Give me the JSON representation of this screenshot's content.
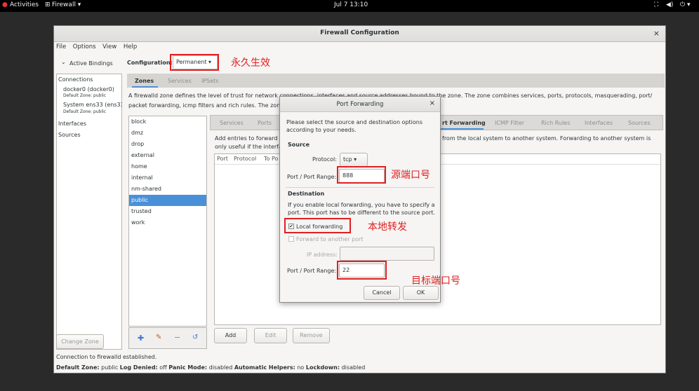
{
  "topbar": {
    "activities": "Activities",
    "app_menu": "Firewall ▾",
    "clock": "Jul 7 13:10"
  },
  "window": {
    "title": "Firewall Configuration",
    "close": "×",
    "menu": [
      "File",
      "Options",
      "View",
      "Help"
    ]
  },
  "left": {
    "active_bindings": "Active Bindings",
    "connections_header": "Connections",
    "conn1_name": "docker0 (docker0)",
    "conn1_zone": "Default Zone: public",
    "conn2_name": "System ens33 (ens33)",
    "conn2_zone": "Default Zone: public",
    "interfaces": "Interfaces",
    "sources": "Sources",
    "change_zone": "Change Zone"
  },
  "config": {
    "label": "Configuration:",
    "value": "Permanent ▾",
    "annotation": "永久生效"
  },
  "top_tabs": [
    "Zones",
    "Services",
    "IPSets"
  ],
  "zone_desc_1": "A firewalld zone defines the level of trust for network connections, interfaces and source addresses bound to the zone. The zone combines services, ports, protocols, masquerading, port/",
  "zone_desc_2": "packet forwarding, icmp filters and rich rules. The zone",
  "zones": [
    "block",
    "dmz",
    "drop",
    "external",
    "home",
    "internal",
    "nm-shared",
    "public",
    "trusted",
    "work"
  ],
  "selected_zone": "public",
  "sub_tabs": {
    "services": "Services",
    "ports": "Ports",
    "port_forwarding": "rt Forwarding",
    "icmp": "ICMP Filter",
    "rich": "Rich Rules",
    "interfaces": "Interfaces",
    "sources": "Sources"
  },
  "pf_desc_left_1": "Add entries to forward p",
  "pf_desc_left_2": "only useful if the interfa",
  "pf_desc_right": "from the local system to another system. Forwarding to another system is",
  "table_headers": [
    "Port",
    "Protocol",
    "To Po"
  ],
  "buttons": {
    "add": "Add",
    "edit": "Edit",
    "remove": "Remove"
  },
  "statusbar": {
    "line1": "Connection to firewalld established.",
    "default_zone_label": "Default Zone:",
    "default_zone": "public",
    "log_denied_label": "Log Denied:",
    "log_denied": "off",
    "panic_label": "Panic Mode:",
    "panic": "disabled",
    "helpers_label": "Automatic Helpers:",
    "helpers": "no",
    "lockdown_label": "Lockdown:",
    "lockdown": "disabled"
  },
  "dialog": {
    "title": "Port Forwarding",
    "close": "×",
    "intro": "Please select the source and destination options according to your needs.",
    "source_header": "Source",
    "protocol_label": "Protocol:",
    "protocol_value": "tcp ▾",
    "port_range_label": "Port / Port Range:",
    "source_port": "888",
    "destination_header": "Destination",
    "dest_desc": "If you enable local forwarding, you have to specify a port. This port has to be different to the source port.",
    "local_forwarding": "Local forwarding",
    "local_forwarding_checked": true,
    "forward_other": "Forward to another port",
    "ip_label": "IP address:",
    "ip_value": "",
    "dest_port": "22",
    "cancel": "Cancel",
    "ok": "OK"
  },
  "annotations": {
    "source_port": "源端口号",
    "local_forward": "本地转发",
    "dest_port": "目标端口号"
  },
  "colors": {
    "annotation": "#e02020",
    "selection": "#4a90d9"
  }
}
